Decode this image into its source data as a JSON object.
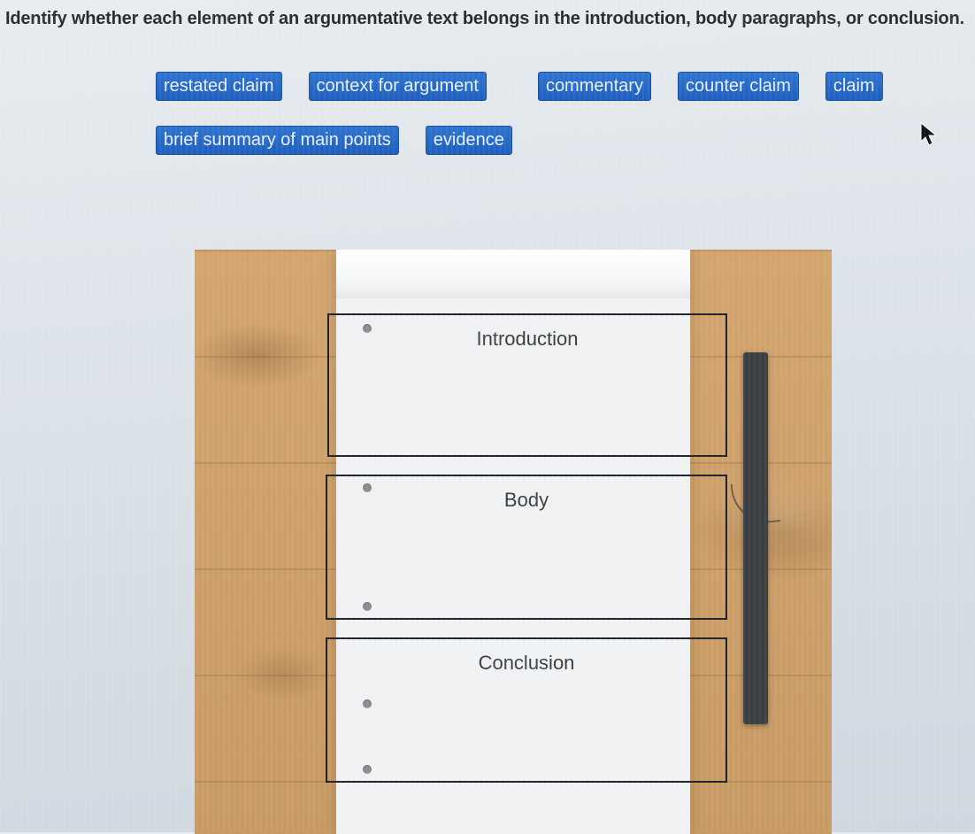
{
  "question": "Identify whether each element of an argumentative text belongs in the introduction, body paragraphs, or conclusion.",
  "drag_rows": [
    [
      "restated claim",
      "context for argument",
      "commentary",
      "counter claim",
      "claim"
    ],
    [
      "brief summary of main points",
      "evidence"
    ]
  ],
  "zones": {
    "introduction": "Introduction",
    "body": "Body",
    "conclusion": "Conclusion"
  }
}
